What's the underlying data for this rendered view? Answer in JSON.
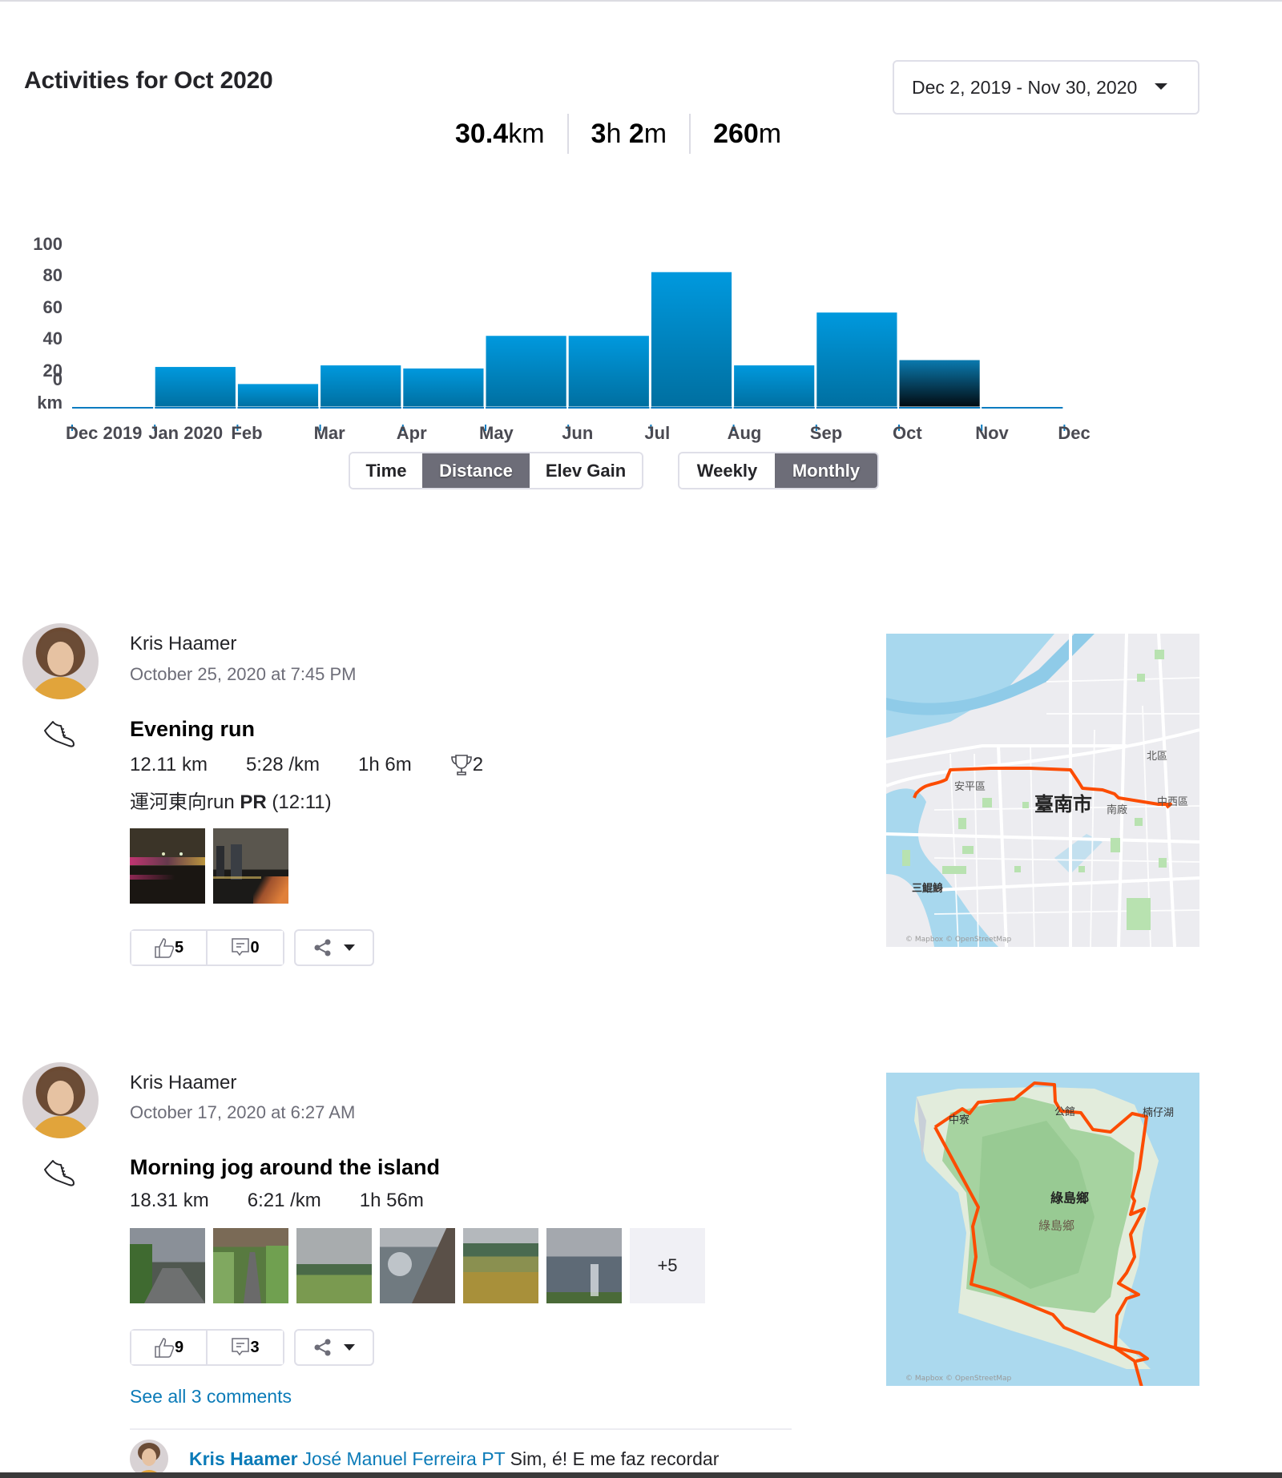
{
  "header": {
    "title": "Activities for Oct 2020",
    "date_range": "Dec 2, 2019 - Nov 30, 2020"
  },
  "summary": {
    "distance_value": "30.4",
    "distance_unit": "km",
    "time_value_h": "3",
    "time_unit_h": "h",
    "time_value_m": "2",
    "time_unit_m": "m",
    "elev_value": "260",
    "elev_unit": "m"
  },
  "colors": {
    "bar_top": "#0099de",
    "bar_bottom": "#006fa0",
    "selected_bar_top": "#0a7bb0",
    "selected_bar_bottom": "#020a10",
    "axis": "#0a7bc0",
    "route": "#fc4c02",
    "link": "#0b7bb8"
  },
  "chart_data": {
    "type": "bar",
    "title": "",
    "xlabel": "",
    "ylabel": "km",
    "y_ticks": [
      "100",
      "80",
      "60",
      "40",
      "20",
      "0"
    ],
    "ylim": [
      0,
      100
    ],
    "categories": [
      "Dec 2019",
      "Jan 2020",
      "Feb",
      "Mar",
      "Apr",
      "May",
      "Jun",
      "Jul",
      "Aug",
      "Sep",
      "Oct",
      "Nov",
      "Dec"
    ],
    "values": [
      0,
      26,
      15,
      27,
      25,
      46,
      46,
      87,
      27,
      61,
      30.4,
      0
    ],
    "selected_category": "Oct",
    "grid": false
  },
  "toggles": {
    "metric": [
      {
        "label": "Time",
        "active": false
      },
      {
        "label": "Distance",
        "active": true
      },
      {
        "label": "Elev Gain",
        "active": false
      }
    ],
    "period": [
      {
        "label": "Weekly",
        "active": false
      },
      {
        "label": "Monthly",
        "active": true
      }
    ]
  },
  "activities": [
    {
      "athlete": "Kris Haamer",
      "timestamp": "October 25, 2020 at 7:45 PM",
      "sport_icon": "running-shoe-icon",
      "title": "Evening run",
      "distance": "12.11 km",
      "pace": "5:28 /km",
      "time": "1h 6m",
      "achievements": "2",
      "segment_name": "運河東向run",
      "segment_badge": "PR",
      "segment_time": "(12:11)",
      "kudos": "5",
      "comments": "0",
      "map_labels": [
        "北區",
        "安平區",
        "臺南市",
        "南廠",
        "中西區",
        "三鯤鯓"
      ],
      "map_attribution": "© Mapbox © OpenStreetMap"
    },
    {
      "athlete": "Kris Haamer",
      "timestamp": "October 17, 2020 at 6:27 AM",
      "sport_icon": "running-shoe-icon",
      "title": "Morning jog around the island",
      "distance": "18.31 km",
      "pace": "6:21 /km",
      "time": "1h 56m",
      "more_photos": "+5",
      "kudos": "9",
      "comments": "3",
      "see_all_comments": "See all 3 comments",
      "comment": {
        "author": "Kris Haamer",
        "mention": "José Manuel Ferreira PT",
        "text": "Sim, é! E me faz recordar"
      },
      "map_labels": [
        "中寮",
        "公館",
        "楠仔湖",
        "綠島鄉",
        "綠島鄉"
      ],
      "map_attribution": "© Mapbox © OpenStreetMap"
    }
  ]
}
